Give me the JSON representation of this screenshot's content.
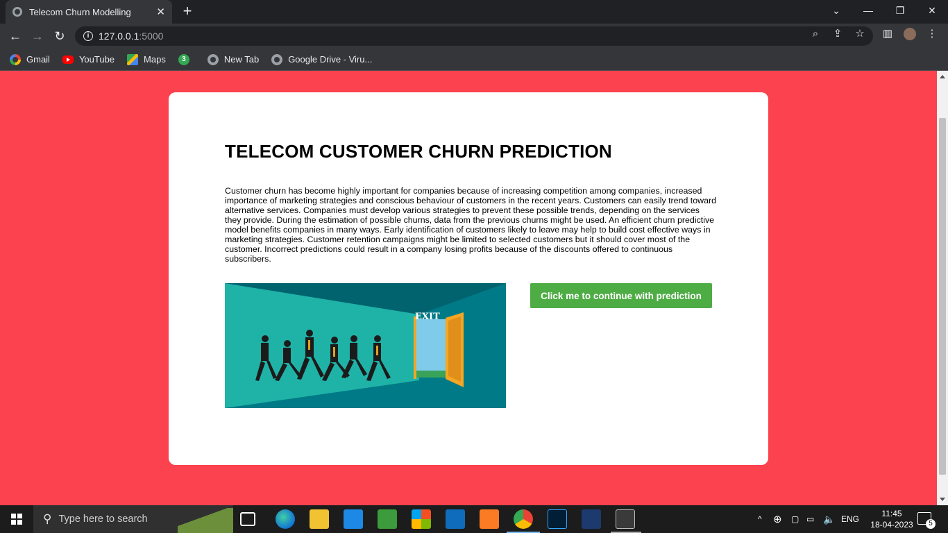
{
  "browser": {
    "tab_title": "Telecom Churn Modelling",
    "tab_close": "✕",
    "new_tab": "+",
    "url_host": "127.0.0.1",
    "url_port": ":5000",
    "window_controls": {
      "minimize": "—",
      "restore": "❐",
      "close": "✕",
      "tabsearch": "⌄"
    }
  },
  "bookmarks": [
    {
      "label": "Gmail",
      "icon": "google-icon"
    },
    {
      "label": "YouTube",
      "icon": "youtube-icon"
    },
    {
      "label": "Maps",
      "icon": "maps-icon"
    },
    {
      "label": "",
      "icon": "whatsapp-badge-icon",
      "badge": "3"
    },
    {
      "label": "New Tab",
      "icon": "globe-icon"
    },
    {
      "label": "Google Drive - Viru...",
      "icon": "globe-icon"
    }
  ],
  "page": {
    "heading": "TELECOM CUSTOMER CHURN PREDICTION",
    "paragraph": "Customer churn has become highly important for companies because of increasing competition among companies, increased importance of marketing strategies and conscious behaviour of customers in the recent years. Customers can easily trend toward alternative services. Companies must develop various strategies to prevent these possible trends, depending on the services they provide. During the estimation of possible churns, data from the previous churns might be used. An efficient churn predictive model benefits companies in many ways. Early identification of customers likely to leave may help to build cost effective ways in marketing strategies. Customer retention campaigns might be limited to selected customers but it should cover most of the customer. Incorrect predictions could result in a company losing profits because of the discounts offered to continuous subscribers.",
    "image_sign": "EXIT",
    "cta_label": "Click me to continue with prediction",
    "colors": {
      "background": "#fc424e",
      "card": "#ffffff",
      "button": "#4dac44",
      "illustration": "#007a87"
    }
  },
  "taskbar": {
    "search_placeholder": "Type here to search",
    "language": "ENG",
    "time": "11:45",
    "date": "18-04-2023",
    "notification_count": "5"
  }
}
